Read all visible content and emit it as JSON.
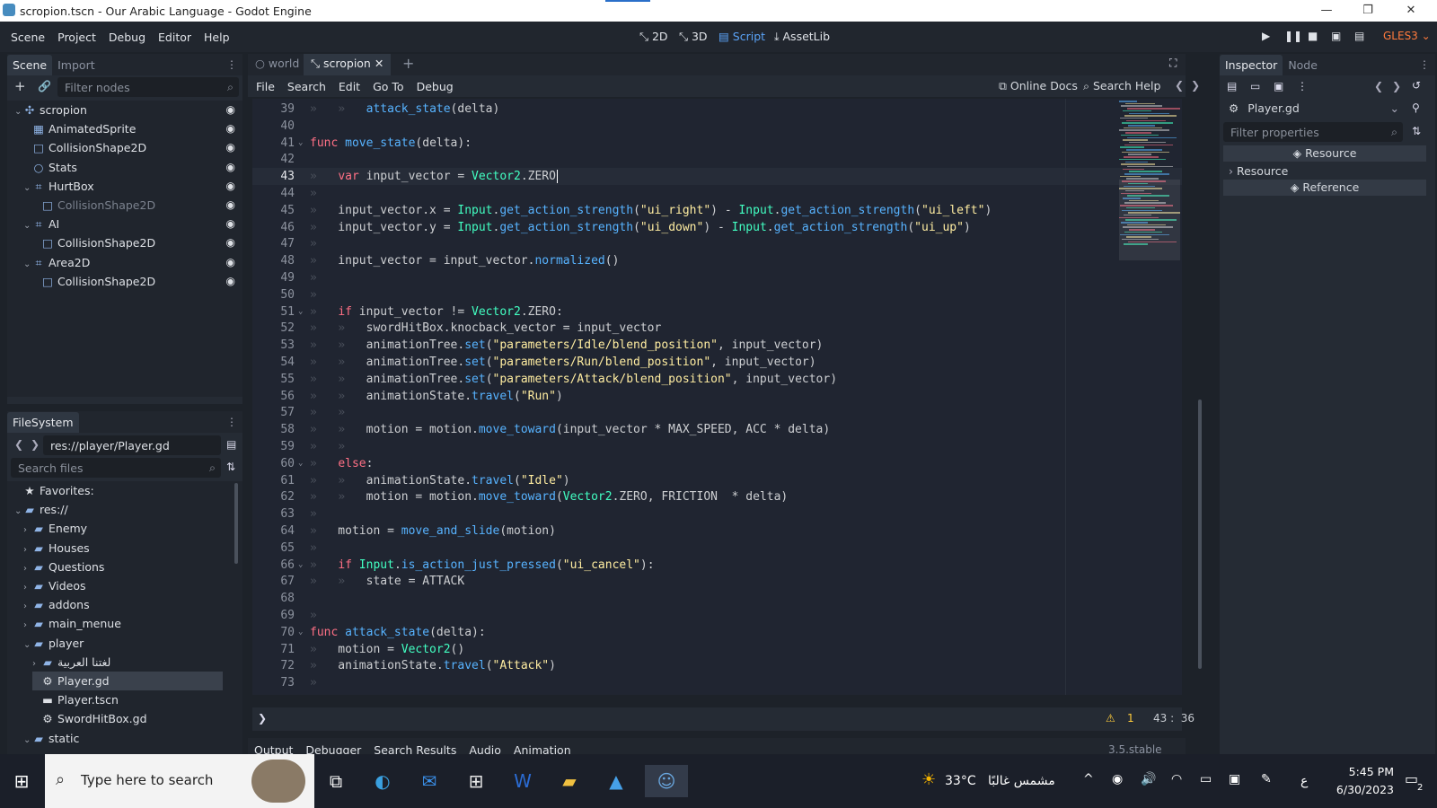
{
  "window": {
    "title": "scropion.tscn - Our Arabic Language - Godot Engine"
  },
  "menu": [
    "Scene",
    "Project",
    "Debug",
    "Editor",
    "Help"
  ],
  "workspaces": [
    {
      "label": "2D",
      "active": false
    },
    {
      "label": "3D",
      "active": false
    },
    {
      "label": "Script",
      "active": true
    },
    {
      "label": "AssetLib",
      "active": false
    }
  ],
  "renderer": "GLES3",
  "scene_dock": {
    "tabs": [
      "Scene",
      "Import"
    ],
    "filter_placeholder": "Filter nodes",
    "nodes": [
      {
        "label": "scropion",
        "depth": 0,
        "icon": "node2d-icon",
        "expanded": true,
        "dim": false
      },
      {
        "label": "AnimatedSprite",
        "depth": 1,
        "icon": "sprite-icon",
        "dim": false
      },
      {
        "label": "CollisionShape2D",
        "depth": 1,
        "icon": "shape-icon",
        "dim": false
      },
      {
        "label": "Stats",
        "depth": 1,
        "icon": "node-icon",
        "dim": false
      },
      {
        "label": "HurtBox",
        "depth": 1,
        "icon": "area-icon",
        "expanded": true,
        "dim": false
      },
      {
        "label": "CollisionShape2D",
        "depth": 2,
        "icon": "shape-icon",
        "dim": true
      },
      {
        "label": "AI",
        "depth": 1,
        "icon": "area-icon",
        "expanded": true,
        "dim": false
      },
      {
        "label": "CollisionShape2D",
        "depth": 2,
        "icon": "shape-icon",
        "dim": false
      },
      {
        "label": "Area2D",
        "depth": 1,
        "icon": "area-icon",
        "expanded": true,
        "dim": false
      },
      {
        "label": "CollisionShape2D",
        "depth": 2,
        "icon": "shape-icon",
        "dim": false
      }
    ]
  },
  "filesystem": {
    "title": "FileSystem",
    "path": "res://player/Player.gd",
    "search_placeholder": "Search files",
    "items": [
      {
        "label": "Favorites:",
        "depth": 0,
        "icon": "star-icon"
      },
      {
        "label": "res://",
        "depth": 0,
        "icon": "folder-icon",
        "expanded": true
      },
      {
        "label": "Enemy",
        "depth": 1,
        "icon": "folder-icon"
      },
      {
        "label": "Houses",
        "depth": 1,
        "icon": "folder-icon"
      },
      {
        "label": "Questions",
        "depth": 1,
        "icon": "folder-icon"
      },
      {
        "label": "Videos",
        "depth": 1,
        "icon": "folder-icon"
      },
      {
        "label": "addons",
        "depth": 1,
        "icon": "folder-icon"
      },
      {
        "label": "main_menue",
        "depth": 1,
        "icon": "folder-icon"
      },
      {
        "label": "player",
        "depth": 1,
        "icon": "folder-icon",
        "expanded": true
      },
      {
        "label": "لغتنا العربية",
        "depth": 2,
        "icon": "folder-icon"
      },
      {
        "label": "Player.gd",
        "depth": 2,
        "icon": "gear-icon",
        "selected": true
      },
      {
        "label": "Player.tscn",
        "depth": 2,
        "icon": "clapper-icon"
      },
      {
        "label": "SwordHitBox.gd",
        "depth": 2,
        "icon": "gear-icon"
      },
      {
        "label": "static",
        "depth": 1,
        "icon": "folder-icon",
        "expanded": true
      }
    ]
  },
  "editor": {
    "tabs": [
      {
        "label": "world",
        "active": false
      },
      {
        "label": "scropion",
        "active": true
      }
    ],
    "script_menu": [
      "File",
      "Search",
      "Edit",
      "Go To",
      "Debug"
    ],
    "online_docs": "Online Docs",
    "search_help": "Search Help",
    "warnings": "1",
    "cursor_pos": "43 :  36",
    "bottom_tabs": [
      "Output",
      "Debugger",
      "Search Results",
      "Audio",
      "Animation"
    ],
    "version": "3.5.stable"
  },
  "code": [
    {
      "n": "39",
      "fold": false,
      "ind": 2,
      "html": "<span class=\"fn\">attack_state</span>(delta)"
    },
    {
      "n": "40",
      "fold": false,
      "ind": 0,
      "html": ""
    },
    {
      "n": "41",
      "fold": true,
      "ind": 0,
      "html": "<span class=\"kw\">func</span> <span class=\"fn\">move_state</span>(delta):"
    },
    {
      "n": "42",
      "fold": false,
      "ind": 0,
      "html": ""
    },
    {
      "n": "43",
      "fold": false,
      "ind": 1,
      "html": "<span class=\"kw\">var</span> input_vector = <span class=\"ty\">Vector2</span>.ZERO",
      "current": true
    },
    {
      "n": "44",
      "fold": false,
      "ind": 1,
      "html": ""
    },
    {
      "n": "45",
      "fold": false,
      "ind": 1,
      "html": "input_vector.x = <span class=\"ty\">Input</span>.<span class=\"fn\">get_action_strength</span>(<span class=\"st\">\"ui_right\"</span>) - <span class=\"ty\">Input</span>.<span class=\"fn\">get_action_strength</span>(<span class=\"st\">\"ui_left\"</span>)"
    },
    {
      "n": "46",
      "fold": false,
      "ind": 1,
      "html": "input_vector.y = <span class=\"ty\">Input</span>.<span class=\"fn\">get_action_strength</span>(<span class=\"st\">\"ui_down\"</span>) - <span class=\"ty\">Input</span>.<span class=\"fn\">get_action_strength</span>(<span class=\"st\">\"ui_up\"</span>)"
    },
    {
      "n": "47",
      "fold": false,
      "ind": 1,
      "html": ""
    },
    {
      "n": "48",
      "fold": false,
      "ind": 1,
      "html": "input_vector = input_vector.<span class=\"fn\">normalized</span>()"
    },
    {
      "n": "49",
      "fold": false,
      "ind": 1,
      "html": ""
    },
    {
      "n": "50",
      "fold": false,
      "ind": 1,
      "html": ""
    },
    {
      "n": "51",
      "fold": true,
      "ind": 1,
      "html": "<span class=\"kw\">if</span> input_vector != <span class=\"ty\">Vector2</span>.ZERO:"
    },
    {
      "n": "52",
      "fold": false,
      "ind": 2,
      "html": "swordHitBox.knocback_vector = input_vector"
    },
    {
      "n": "53",
      "fold": false,
      "ind": 2,
      "html": "animationTree.<span class=\"fn\">set</span>(<span class=\"st\">\"parameters/Idle/blend_position\"</span>, input_vector)"
    },
    {
      "n": "54",
      "fold": false,
      "ind": 2,
      "html": "animationTree.<span class=\"fn\">set</span>(<span class=\"st\">\"parameters/Run/blend_position\"</span>, input_vector)"
    },
    {
      "n": "55",
      "fold": false,
      "ind": 2,
      "html": "animationTree.<span class=\"fn\">set</span>(<span class=\"st\">\"parameters/Attack/blend_position\"</span>, input_vector)"
    },
    {
      "n": "56",
      "fold": false,
      "ind": 2,
      "html": "animationState.<span class=\"fn\">travel</span>(<span class=\"st\">\"Run\"</span>)"
    },
    {
      "n": "57",
      "fold": false,
      "ind": 2,
      "html": ""
    },
    {
      "n": "58",
      "fold": false,
      "ind": 2,
      "html": "motion = motion.<span class=\"fn\">move_toward</span>(input_vector * MAX_SPEED, ACC * delta)"
    },
    {
      "n": "59",
      "fold": false,
      "ind": 2,
      "html": ""
    },
    {
      "n": "60",
      "fold": true,
      "ind": 1,
      "html": "<span class=\"kw\">else</span>:"
    },
    {
      "n": "61",
      "fold": false,
      "ind": 2,
      "html": "animationState.<span class=\"fn\">travel</span>(<span class=\"st\">\"Idle\"</span>)"
    },
    {
      "n": "62",
      "fold": false,
      "ind": 2,
      "html": "motion = motion.<span class=\"fn\">move_toward</span>(<span class=\"ty\">Vector2</span>.ZERO, FRICTION  * delta)"
    },
    {
      "n": "63",
      "fold": false,
      "ind": 1,
      "html": ""
    },
    {
      "n": "64",
      "fold": false,
      "ind": 1,
      "html": "motion = <span class=\"fn\">move_and_slide</span>(motion)"
    },
    {
      "n": "65",
      "fold": false,
      "ind": 1,
      "html": ""
    },
    {
      "n": "66",
      "fold": true,
      "ind": 1,
      "html": "<span class=\"kw\">if</span> <span class=\"ty\">Input</span>.<span class=\"fn\">is_action_just_pressed</span>(<span class=\"st\">\"ui_cancel\"</span>):"
    },
    {
      "n": "67",
      "fold": false,
      "ind": 2,
      "html": "state = ATTACK"
    },
    {
      "n": "68",
      "fold": false,
      "ind": 0,
      "html": ""
    },
    {
      "n": "69",
      "fold": false,
      "ind": 1,
      "html": ""
    },
    {
      "n": "70",
      "fold": true,
      "ind": 0,
      "html": "<span class=\"kw\">func</span> <span class=\"fn\">attack_state</span>(delta):"
    },
    {
      "n": "71",
      "fold": false,
      "ind": 1,
      "html": "motion = <span class=\"ty\">Vector2</span>()"
    },
    {
      "n": "72",
      "fold": false,
      "ind": 1,
      "html": "animationState.<span class=\"fn\">travel</span>(<span class=\"st\">\"Attack\"</span>)"
    },
    {
      "n": "73",
      "fold": false,
      "ind": 1,
      "html": ""
    }
  ],
  "inspector": {
    "tabs": [
      "Inspector",
      "Node"
    ],
    "object": "Player.gd",
    "filter_placeholder": "Filter properties",
    "resource_header": "Resource",
    "resource_row": "Resource",
    "reference_header": "Reference"
  },
  "taskbar": {
    "search_placeholder": "Type here to search",
    "temperature": "33°C",
    "weather": "مشمس غالبًا",
    "lang": "ع",
    "time": "5:45 PM",
    "date": "6/30/2023",
    "notif_count": "2"
  }
}
